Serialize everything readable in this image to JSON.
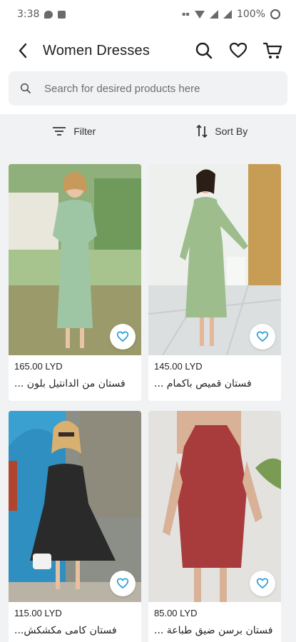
{
  "status_bar": {
    "time": "3:38",
    "battery": "100%"
  },
  "header": {
    "title": "Women Dresses",
    "icons": [
      "back-arrow-icon",
      "search-icon",
      "heart-icon",
      "cart-icon"
    ]
  },
  "search": {
    "placeholder": "Search for desired products here"
  },
  "toolbar": {
    "filter_label": "Filter",
    "sort_label": "Sort By"
  },
  "products": [
    {
      "price": "165.00 LYD",
      "name": "فستان من الدانتيل بلون ..."
    },
    {
      "price": "145.00 LYD",
      "name": "فستان قميص باكمام ..."
    },
    {
      "price": "115.00 LYD",
      "name": "فستان كامى مكشكش..."
    },
    {
      "price": "85.00 LYD",
      "name": "فستان برسن ضيق طباعة ..."
    }
  ],
  "colors": {
    "accent_heart": "#2a9fd6",
    "surface": "#f1f2f4",
    "text": "#1a1a1a"
  }
}
